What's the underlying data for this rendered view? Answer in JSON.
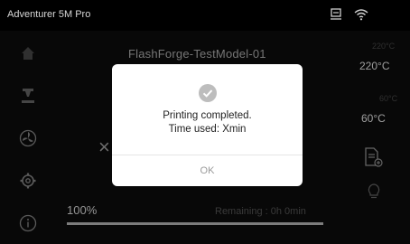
{
  "topbar": {
    "title": "Adventurer 5M Pro",
    "icons": [
      "usb-icon",
      "wifi-icon"
    ]
  },
  "sidebar": {
    "items": [
      {
        "icon": "home-icon"
      },
      {
        "icon": "nozzle-icon"
      },
      {
        "icon": "fan-icon"
      },
      {
        "icon": "gear-icon"
      },
      {
        "icon": "info-icon"
      }
    ]
  },
  "main": {
    "model_name": "FlashForge-TestModel-01",
    "close_symbol": "×",
    "nozzle": {
      "target": "220°C",
      "current": "220°C"
    },
    "bed": {
      "target": "60°C",
      "current": "60°C"
    },
    "progress": {
      "percent_label": "100%",
      "fraction": 1.0,
      "remaining": "Remaining : 0h 0min"
    }
  },
  "dialog": {
    "line1": "Printing completed.",
    "line2": "Time used: Xmin",
    "ok_label": "OK"
  },
  "colors": {
    "background": "#0d0d0d",
    "dialog_bg": "#ffffff",
    "check_gray": "#bdbdbd"
  }
}
